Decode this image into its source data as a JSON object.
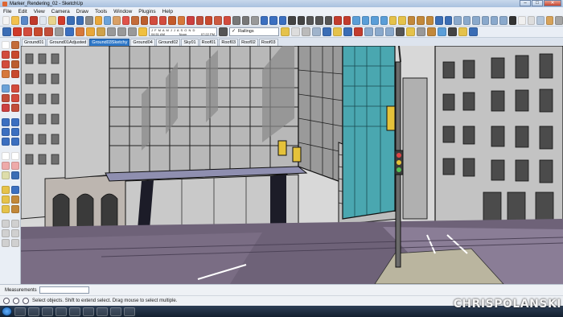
{
  "window": {
    "title": "Marker_Rendering_02 - SketchUp",
    "controls": [
      "minimize",
      "maximize",
      "close"
    ]
  },
  "menu": [
    "File",
    "Edit",
    "View",
    "Camera",
    "Draw",
    "Tools",
    "Window",
    "Plugins",
    "Help"
  ],
  "toolbar": {
    "shadow_months": "J F M A M J J A S O N D",
    "shadow_time_start": "04:51 AM",
    "shadow_time_noon": "Noon",
    "shadow_time_end": "07:22 PM",
    "layer": "Railings"
  },
  "scene_tabs": [
    {
      "label": "Ground01",
      "active": false
    },
    {
      "label": "Ground01Adjusted",
      "active": false
    },
    {
      "label": "Ground03Sketchy",
      "active": true
    },
    {
      "label": "Ground04",
      "active": false
    },
    {
      "label": "Ground02",
      "active": false
    },
    {
      "label": "Sky01",
      "active": false
    },
    {
      "label": "Roof01",
      "active": false
    },
    {
      "label": "Roof03",
      "active": false
    },
    {
      "label": "Roof02",
      "active": false
    },
    {
      "label": "Roof03",
      "active": false
    }
  ],
  "measurements": {
    "label": "Measurements",
    "value": ""
  },
  "status": {
    "message": "Select objects. Shift to extend select. Drag mouse to select multiple."
  },
  "watermark": "CHRISPOLANSKI",
  "colors": {
    "selected_tab": "#2f78c8",
    "window_chrome": "#a9c1df",
    "teal_glass": "#4aa7b0",
    "pavement": "#6e6278"
  }
}
